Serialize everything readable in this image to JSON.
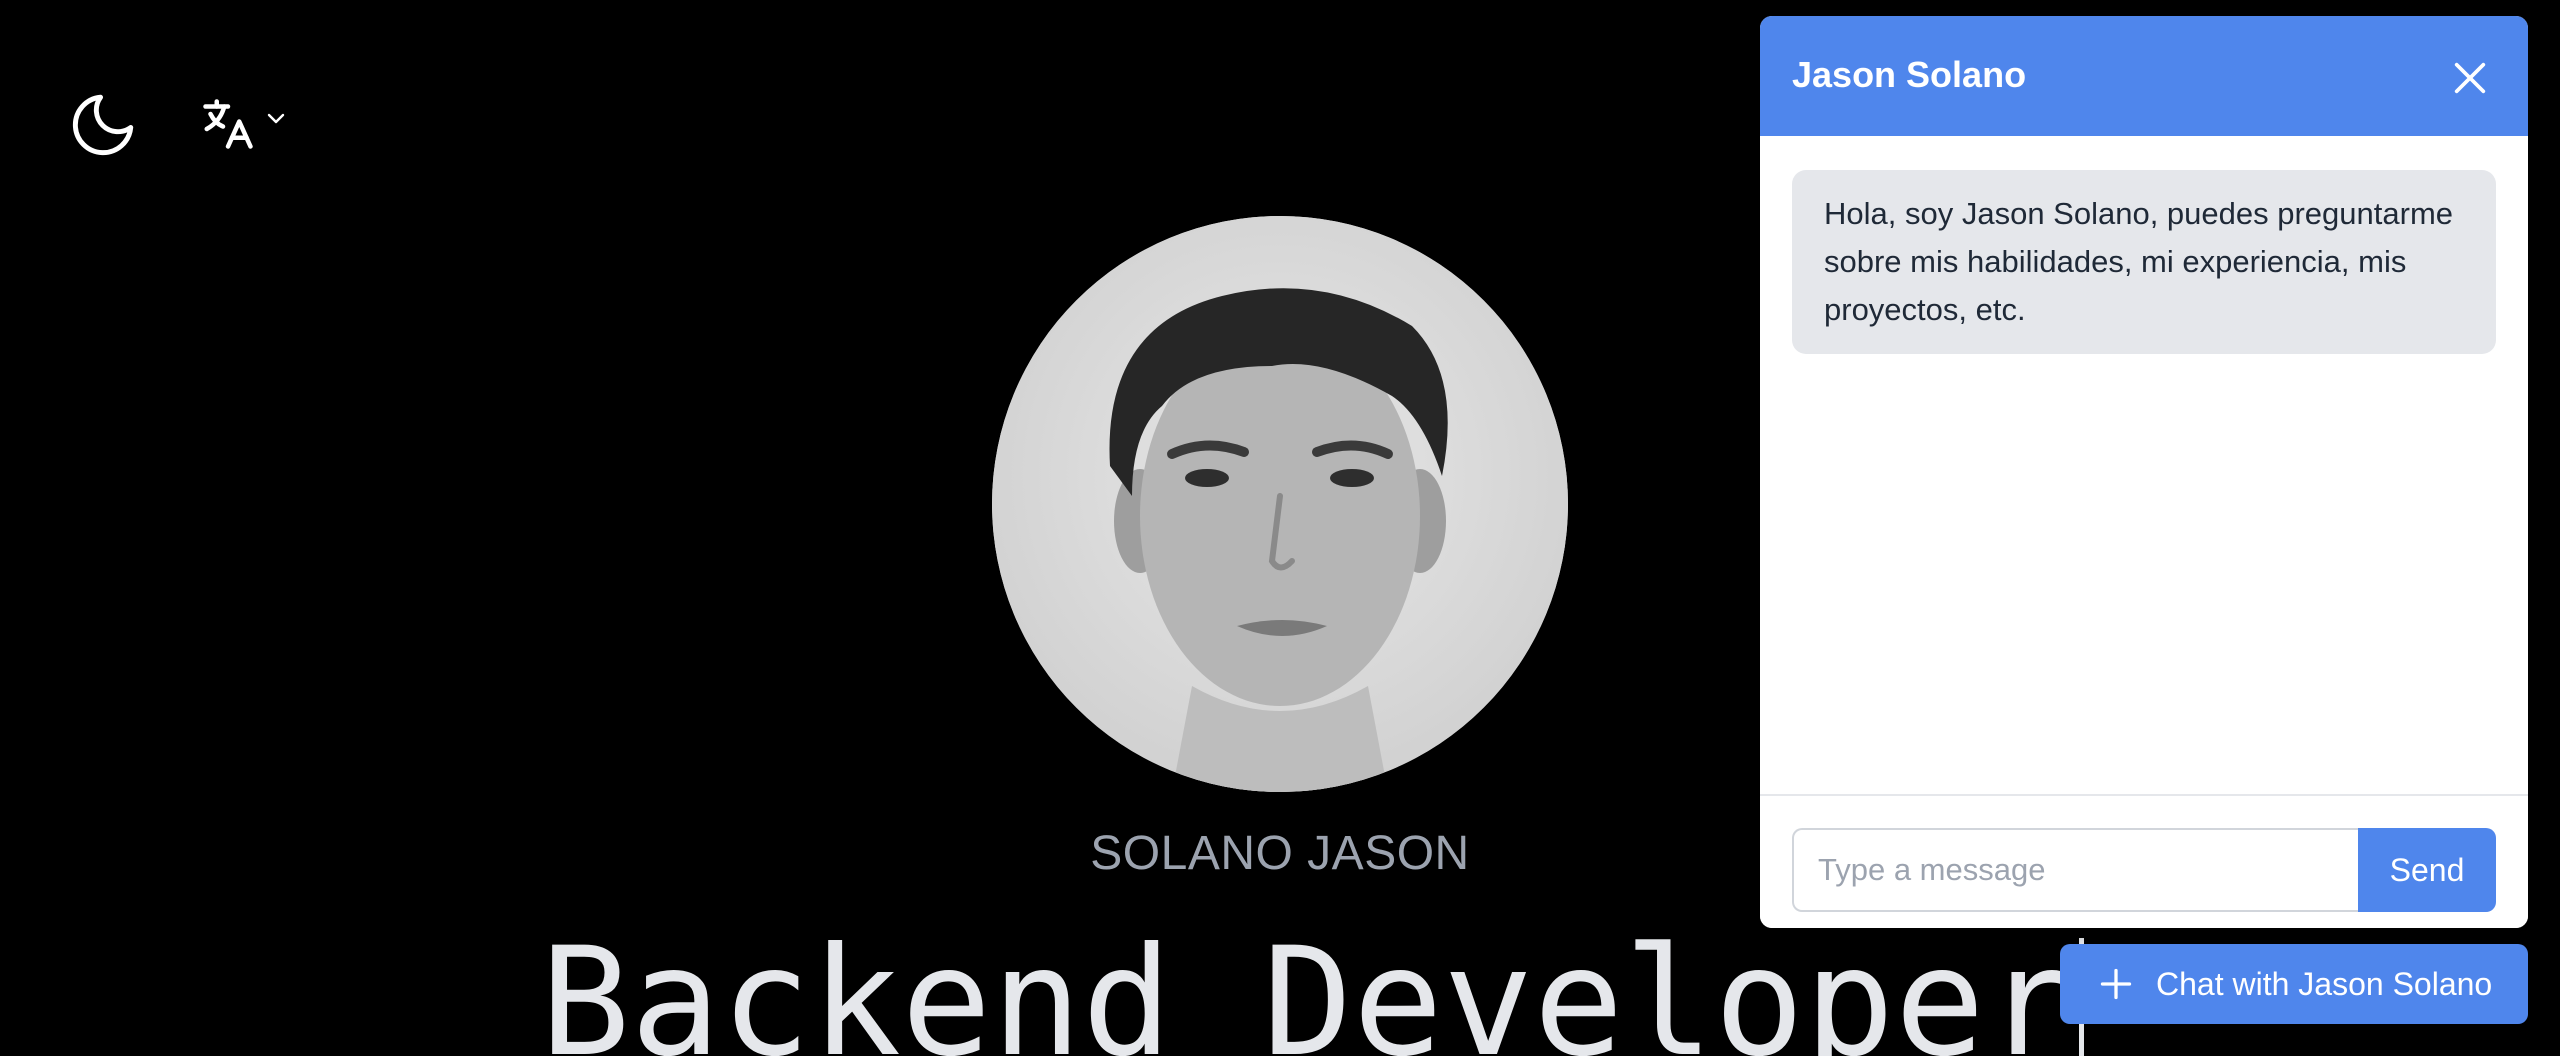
{
  "header": {
    "theme_toggle_icon": "moon-icon",
    "language_icon": "translate-icon",
    "language_dropdown_icon": "chevron-down-icon"
  },
  "profile": {
    "name": "SOLANO JASON",
    "role": "Backend Developer"
  },
  "chat": {
    "title": "Jason Solano",
    "close_icon": "close-icon",
    "messages": [
      {
        "from": "bot",
        "text": "Hola, soy Jason Solano, puedes preguntarme sobre mis habilidades, mi experiencia, mis proyectos, etc."
      }
    ],
    "input_placeholder": "Type a message",
    "input_value": "",
    "send_label": "Send",
    "launcher_label": "Chat with Jason Solano",
    "launcher_icon": "plus-icon"
  },
  "colors": {
    "background": "#000000",
    "accent": "#4f86ec",
    "bubble": "#e5e7eb",
    "name_text": "#9ca3af",
    "role_text": "#e5e7eb"
  }
}
